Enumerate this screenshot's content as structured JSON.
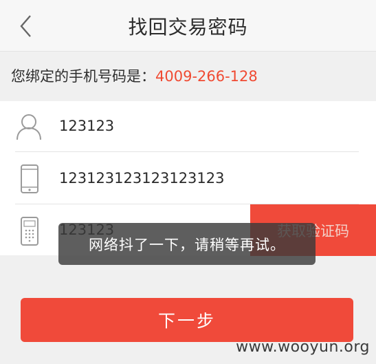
{
  "header": {
    "title": "找回交易密码"
  },
  "bound": {
    "label": "您绑定的手机号码是：",
    "phone": "4009-266-128"
  },
  "form": {
    "username_value": "123123",
    "phone_value": "123123123123123123",
    "code_value": "123123",
    "get_code_label": "获取验证码"
  },
  "toast": {
    "message": "网络抖了一下，请稍等再试。"
  },
  "next_button": {
    "label": "下一步"
  },
  "watermark": {
    "text": "www.wooyun.org"
  },
  "colors": {
    "accent": "#f04a3a",
    "phone_highlight": "#f04a32",
    "icon_gray": "#9a9a9a"
  }
}
